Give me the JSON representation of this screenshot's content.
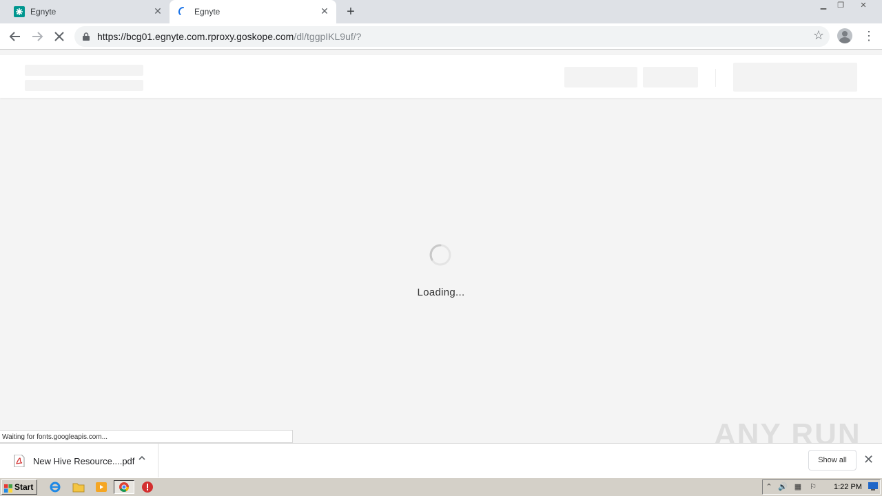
{
  "browser": {
    "tabs": [
      {
        "title": "Egnyte",
        "state": "loaded",
        "favicon": "egnyte-logo-icon"
      },
      {
        "title": "Egnyte",
        "state": "loading",
        "favicon": "loading-spinner-icon"
      }
    ],
    "new_tab": "+",
    "address": {
      "host": "https://bcg01.egnyte.com.rproxy.goskope.com",
      "path": "/dl/tggpIKL9uf/?"
    }
  },
  "page": {
    "loading_text": "Loading..."
  },
  "status": {
    "text": "Waiting for fonts.googleapis.com..."
  },
  "downloads": {
    "item_name": "New Hive Resource....pdf",
    "show_all_label": "Show all"
  },
  "watermark": "ANY RUN",
  "taskbar": {
    "start_label": "Start",
    "clock": "1:22 PM"
  },
  "colors": {
    "accent": "#1a73e8",
    "egnyte_brand": "#00968f",
    "tab_strip": "#dee1e6"
  }
}
